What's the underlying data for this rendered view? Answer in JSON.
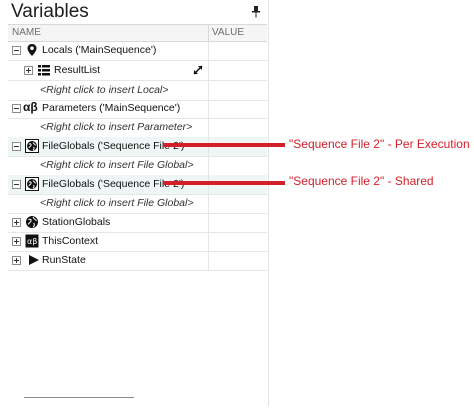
{
  "panel": {
    "title": "Variables"
  },
  "header": {
    "name": "NAME",
    "value": "VALUE"
  },
  "rows": [
    {
      "label": "Locals ('MainSequence')"
    },
    {
      "label": "ResultList"
    },
    {
      "label": "<Right click to insert Local>"
    },
    {
      "label": "Parameters ('MainSequence')"
    },
    {
      "label": "<Right click to insert Parameter>"
    },
    {
      "label": "FileGlobals ('Sequence File 2')"
    },
    {
      "label": "<Right click to insert File Global>"
    },
    {
      "label": "FileGlobals ('Sequence File 2')"
    },
    {
      "label": "<Right click to insert File Global>"
    },
    {
      "label": "StationGlobals"
    },
    {
      "label": "ThisContext"
    },
    {
      "label": "RunState"
    }
  ],
  "annotations": [
    {
      "text": "\"Sequence File 2\" - Per Execution"
    },
    {
      "text": "\"Sequence File 2\" - Shared"
    }
  ],
  "colors": {
    "annotation": "#d21f2a",
    "highlight_row": "#eef7f6"
  }
}
